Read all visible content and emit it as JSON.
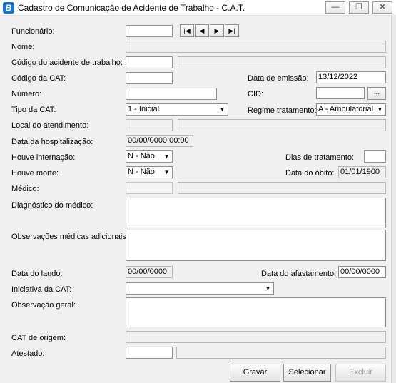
{
  "window": {
    "title": "Cadastro de Comunicação de Acidente de Trabalho - C.A.T.",
    "app_icon_letter": "B",
    "minimize_label": "—",
    "restore_label": "❐",
    "close_label": "✕"
  },
  "form": {
    "funcionario_label": "Funcionário:",
    "funcionario_value": "",
    "nome_label": "Nome:",
    "nome_value": "",
    "codigo_acidente_label": "Código do acidente de trabalho:",
    "codigo_cat_label": "Código da CAT:",
    "data_emissao_label": "Data de emissão:",
    "data_emissao_value": "13/12/2022",
    "numero_label": "Número:",
    "cid_label": "CID:",
    "cid_lookup_label": "...",
    "tipo_cat_label": "Tipo da CAT:",
    "tipo_cat_value": "1 - Inicial",
    "regime_label": "Regime tratamento:",
    "regime_value": "A - Ambulatorial",
    "local_atendimento_label": "Local do atendimento:",
    "data_hospitalizacao_label": "Data da hospitalização:",
    "data_hospitalizacao_value": "00/00/0000 00:00",
    "houve_internacao_label": "Houve internação:",
    "houve_internacao_value": "N - Não",
    "dias_tratamento_label": "Dias de tratamento:",
    "houve_morte_label": "Houve morte:",
    "houve_morte_value": "N - Não",
    "data_obito_label": "Data do óbito:",
    "data_obito_value": "01/01/1900",
    "medico_label": "Médico:",
    "diagnostico_label": "Diagnóstico do médico:",
    "observacoes_medicas_label": "Observações médicas adicionais:",
    "data_laudo_label": "Data do laudo:",
    "data_laudo_value": "00/00/0000",
    "data_afastamento_label": "Data do afastamento:",
    "data_afastamento_value": "00/00/0000",
    "iniciativa_label": "Iniciativa da CAT:",
    "iniciativa_value": "",
    "observacao_geral_label": "Observação geral:",
    "cat_origem_label": "CAT de origem:",
    "atestado_label": "Atestado:"
  },
  "nav": {
    "first": "|◀",
    "prev": "◀",
    "next": "▶",
    "last": "▶|"
  },
  "buttons": {
    "gravar": "Gravar",
    "selecionar": "Selecionar",
    "excluir": "Excluir"
  }
}
